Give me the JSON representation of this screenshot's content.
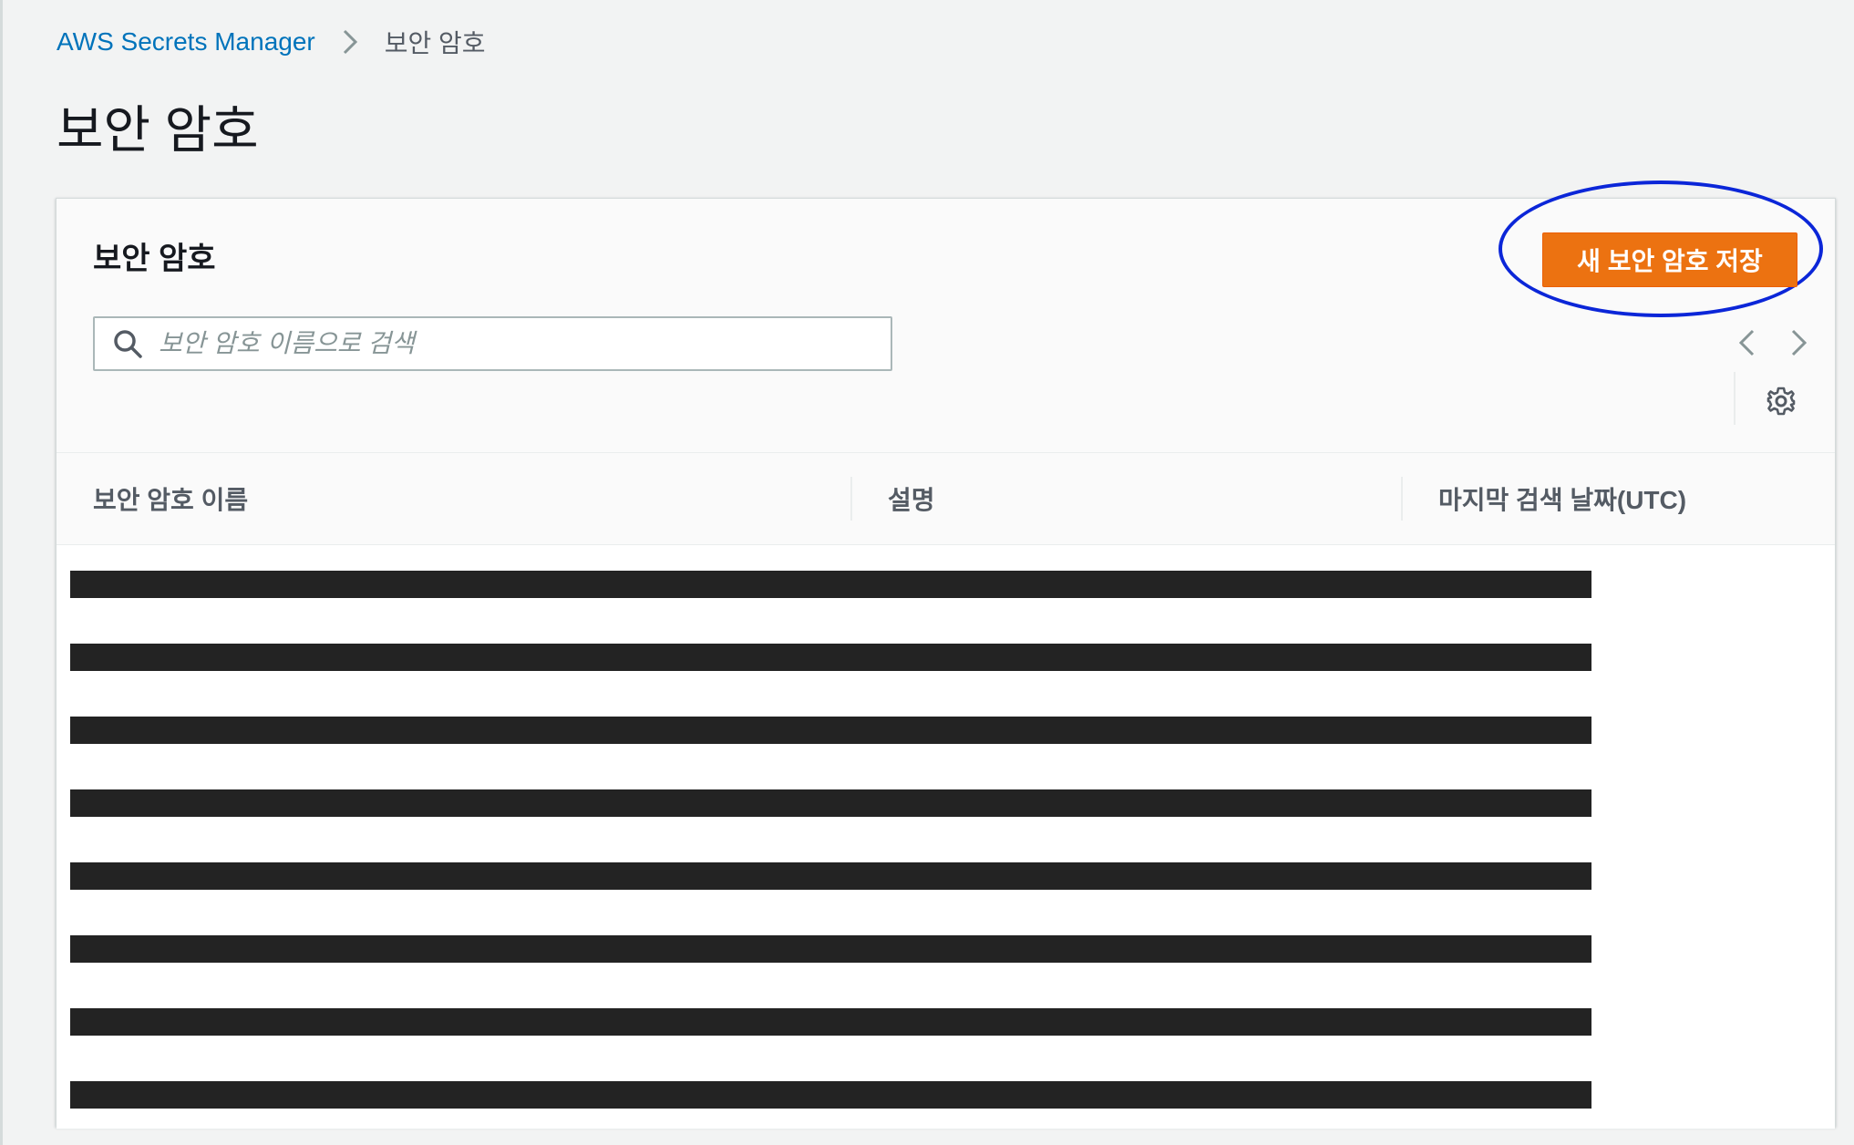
{
  "breadcrumb": {
    "root": "AWS Secrets Manager",
    "current": "보안 암호"
  },
  "page": {
    "title": "보안 암호"
  },
  "panel": {
    "title": "보안 암호",
    "create_button_label": "새 보안 암호 저장",
    "search_placeholder": "보안 암호 이름으로 검색",
    "search_value": ""
  },
  "table": {
    "columns": [
      "보안 암호 이름",
      "설명",
      "마지막 검색 날짜(UTC)"
    ],
    "rows": [
      {
        "redacted": true
      },
      {
        "redacted": true
      },
      {
        "redacted": true
      },
      {
        "redacted": true
      },
      {
        "redacted": true
      },
      {
        "redacted": true
      },
      {
        "redacted": true
      },
      {
        "redacted": true
      }
    ]
  },
  "colors": {
    "link": "#0073bb",
    "primary_button": "#ec7211",
    "highlight_ellipse": "#0b26d8",
    "redaction": "#232323",
    "background": "#f2f3f3"
  },
  "icons": {
    "breadcrumb_separator": "chevron-right-icon",
    "search": "search-icon",
    "pager_prev": "chevron-left-icon",
    "pager_next": "chevron-right-icon",
    "settings": "gear-icon"
  }
}
